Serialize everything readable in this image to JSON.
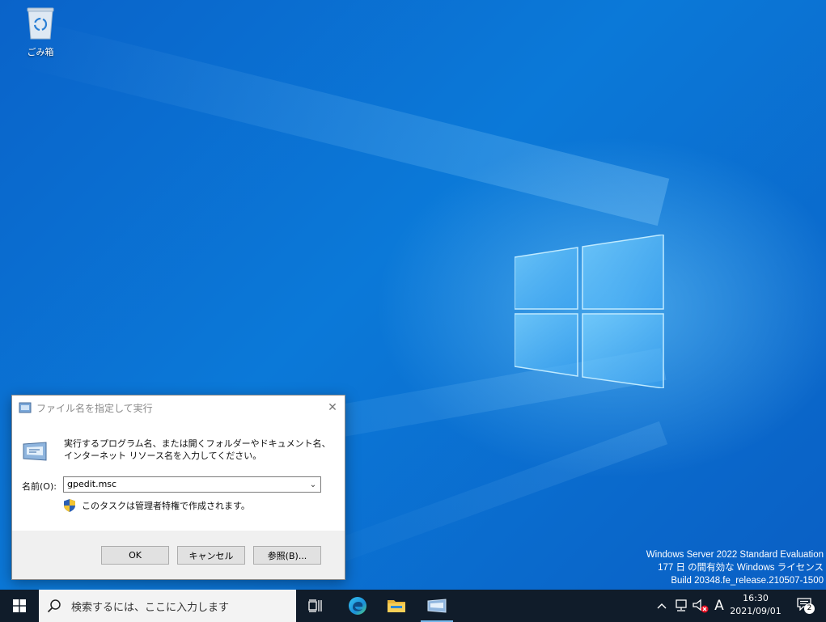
{
  "desktop": {
    "recycle_bin_label": "ごみ箱",
    "watermark": {
      "line1": "Windows Server 2022 Standard Evaluation",
      "line2": "177 日 の間有効な Windows ライセンス",
      "line3": "Build 20348.fe_release.210507-1500"
    }
  },
  "run_dialog": {
    "title": "ファイル名を指定して実行",
    "close_glyph": "✕",
    "description": "実行するプログラム名、または開くフォルダーやドキュメント名、インターネット リソース名を入力してください。",
    "name_label": "名前(O):",
    "name_value": "gpedit.msc",
    "admin_note": "このタスクは管理者特権で作成されます。",
    "buttons": {
      "ok": "OK",
      "cancel": "キャンセル",
      "browse": "参照(B)..."
    }
  },
  "taskbar": {
    "search_placeholder": "検索するには、ここに入力します",
    "ime_indicator": "A",
    "clock_time": "16:30",
    "clock_date": "2021/09/01",
    "notification_count": "2",
    "icons": [
      "start-icon",
      "task-view-icon",
      "edge-icon",
      "file-explorer-icon",
      "run-app-icon"
    ],
    "tray_icons": [
      "chevron-up-icon",
      "network-icon",
      "volume-muted-icon"
    ]
  },
  "colors": {
    "desktop_blue": "#0b79d8",
    "taskbar": "#101c2a",
    "dialog_footer": "#f0f0f0",
    "button_face": "#e1e1e1"
  }
}
